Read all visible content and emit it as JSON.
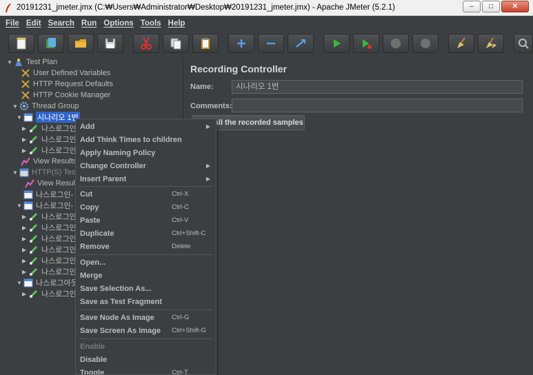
{
  "window": {
    "title": "20191231_jmeter.jmx (C:₩Users₩Administrator₩Desktop₩20191231_jmeter.jmx) - Apache JMeter (5.2.1)",
    "minimize": "–",
    "maximize": "□",
    "close": "✕"
  },
  "menubar": [
    "File",
    "Edit",
    "Search",
    "Run",
    "Options",
    "Tools",
    "Help"
  ],
  "toolbar": [
    "new-icon",
    "templates-icon",
    "open-icon",
    "save-icon",
    "cut-icon",
    "copy-icon",
    "paste-icon",
    "expand-icon",
    "collapse-icon",
    "toggle-icon",
    "start-icon",
    "start-no-pauses-icon",
    "stop-icon",
    "shutdown-icon",
    "clear-icon",
    "clear-all-icon",
    "search-icon"
  ],
  "tree": [
    {
      "label": "Test Plan",
      "icon": "test-plan-icon"
    },
    {
      "label": "User Defined Variables",
      "icon": "wrench-icon"
    },
    {
      "label": "HTTP Request Defaults",
      "icon": "wrench-icon"
    },
    {
      "label": "HTTP Cookie Manager",
      "icon": "wrench-icon"
    },
    {
      "label": "Thread Group",
      "icon": "gear-icon"
    },
    {
      "label": "시나리오 1번",
      "icon": "controller-icon"
    },
    {
      "label": "나스로그인",
      "icon": "sampler-icon"
    },
    {
      "label": "나스로그인",
      "icon": "sampler-icon"
    },
    {
      "label": "나스로그인",
      "icon": "sampler-icon"
    },
    {
      "label": "View Results",
      "icon": "listener-icon"
    },
    {
      "label": "HTTP(S) Test",
      "icon": "controller-icon"
    },
    {
      "label": "View Result",
      "icon": "listener-icon"
    },
    {
      "label": "나스로그인-",
      "icon": "controller-icon"
    },
    {
      "label": "나스로그인-",
      "icon": "controller-icon"
    },
    {
      "label": "나스로그인",
      "icon": "sampler-icon"
    },
    {
      "label": "나스로그인",
      "icon": "sampler-icon"
    },
    {
      "label": "나스로그인",
      "icon": "sampler-icon"
    },
    {
      "label": "나스로그인",
      "icon": "sampler-icon"
    },
    {
      "label": "나스로그인",
      "icon": "sampler-icon"
    },
    {
      "label": "나스로그인",
      "icon": "sampler-icon"
    },
    {
      "label": "나스로그아웃",
      "icon": "controller-icon"
    },
    {
      "label": "나스로그인",
      "icon": "sampler-icon"
    }
  ],
  "panel": {
    "title": "Recording Controller",
    "name_label": "Name:",
    "name_value": "시나리오 1번",
    "comments_label": "Comments:",
    "comments_value": "",
    "clear_button": "Clear all the recorded samples"
  },
  "context_menu": {
    "items": [
      {
        "label": "Add",
        "submenu": true
      },
      {
        "label": "Add Think Times to children"
      },
      {
        "label": "Apply Naming Policy"
      },
      {
        "label": "Change Controller",
        "submenu": true
      },
      {
        "label": "Insert Parent",
        "submenu": true
      },
      {
        "label": "Cut",
        "shortcut": "Ctrl-X"
      },
      {
        "label": "Copy",
        "shortcut": "Ctrl-C"
      },
      {
        "label": "Paste",
        "shortcut": "Ctrl-V"
      },
      {
        "label": "Duplicate",
        "shortcut": "Ctrl+Shift-C"
      },
      {
        "label": "Remove",
        "shortcut": "Delete"
      },
      {
        "label": "Open..."
      },
      {
        "label": "Merge"
      },
      {
        "label": "Save Selection As..."
      },
      {
        "label": "Save as Test Fragment"
      },
      {
        "label": "Save Node As Image",
        "shortcut": "Ctrl-G"
      },
      {
        "label": "Save Screen As Image",
        "shortcut": "Ctrl+Shift-G"
      },
      {
        "label": "Enable",
        "disabled": true
      },
      {
        "label": "Disable"
      },
      {
        "label": "Toggle",
        "shortcut": "Ctrl-T"
      }
    ]
  }
}
